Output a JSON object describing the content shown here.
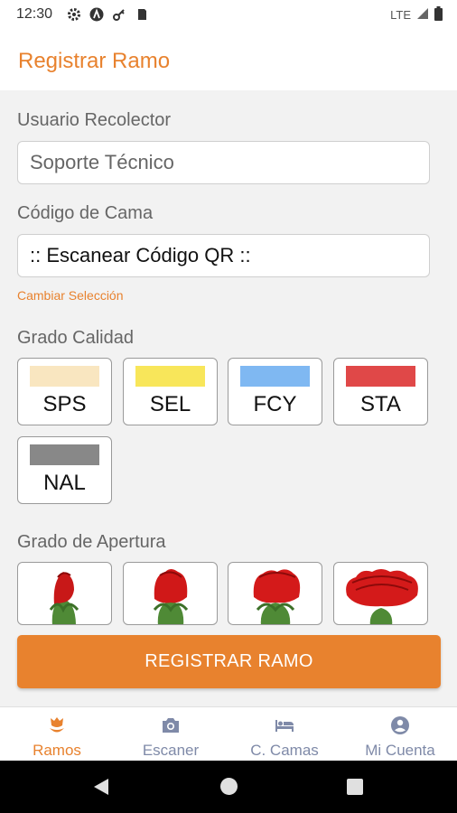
{
  "status_bar": {
    "time": "12:30",
    "network": "LTE"
  },
  "app_bar": {
    "title": "Registrar Ramo"
  },
  "form": {
    "user_label": "Usuario Recolector",
    "user_value": "Soporte Técnico",
    "bed_label": "Código de Cama",
    "bed_value": ":: Escanear Código QR ::",
    "change_link": "Cambiar Selección",
    "quality_label": "Grado Calidad",
    "quality_grades": [
      {
        "label": "SPS",
        "color": "#f9e6c0"
      },
      {
        "label": "SEL",
        "color": "#f8e65a"
      },
      {
        "label": "FCY",
        "color": "#7fb8f2"
      },
      {
        "label": "STA",
        "color": "#e04848"
      },
      {
        "label": "NAL",
        "color": "#888888"
      }
    ],
    "opening_label": "Grado de Apertura",
    "opening_grades": [
      "flower-bud-1-icon",
      "flower-bud-2-icon",
      "flower-bud-3-icon",
      "flower-open-icon"
    ]
  },
  "register_button": "REGISTRAR RAMO",
  "bottom_nav": [
    {
      "label": "Ramos",
      "icon": "flower-icon",
      "active": true
    },
    {
      "label": "Escaner",
      "icon": "camera-icon",
      "active": false
    },
    {
      "label": "C. Camas",
      "icon": "bed-icon",
      "active": false
    },
    {
      "label": "Mi Cuenta",
      "icon": "account-icon",
      "active": false
    }
  ],
  "colors": {
    "accent": "#e8822e",
    "background": "#f2f2f2",
    "nav_inactive": "#7f8aa8"
  }
}
